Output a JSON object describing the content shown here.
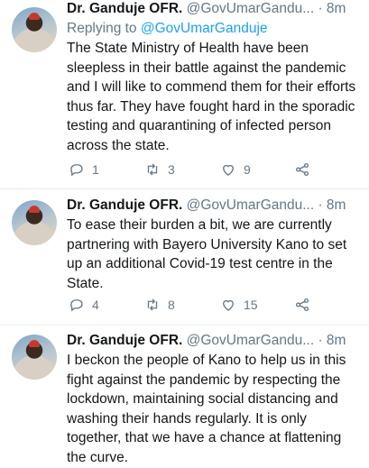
{
  "tweets": [
    {
      "name": "Dr. Ganduje OFR.",
      "handle": "@GovUmarGandu...",
      "time": "· 8m",
      "reply_prefix": "Replying to ",
      "reply_to": "@GovUmarGanduje",
      "text": "The State Ministry of Health have been sleepless in their battle against the pandemic and I will like to commend them for their efforts thus far. They have fought hard in the sporadic testing and quarantining of infected person across the state.",
      "replies": "1",
      "retweets": "3",
      "likes": "9"
    },
    {
      "name": "Dr. Ganduje OFR.",
      "handle": "@GovUmarGandu...",
      "time": "· 8m",
      "text": "To ease their burden a bit, we are currently partnering with Bayero University Kano to set up an additional Covid-19 test centre in the State.",
      "replies": "4",
      "retweets": "8",
      "likes": "15"
    },
    {
      "name": "Dr. Ganduje OFR.",
      "handle": "@GovUmarGandu...",
      "time": "· 8m",
      "text": "I beckon the people of Kano to help us in this fight against the pandemic by respecting the lockdown, maintaining social distancing and washing their hands regularly.  It is only together, that we have a chance at flattening the curve."
    }
  ],
  "icons": {
    "reply": "reply-icon",
    "retweet": "retweet-icon",
    "like": "like-icon",
    "share": "share-icon",
    "menu": "chevron-down-icon"
  },
  "colors": {
    "link": "#1da1f2",
    "secondary": "#657786",
    "divider": "#e6ecf0"
  }
}
